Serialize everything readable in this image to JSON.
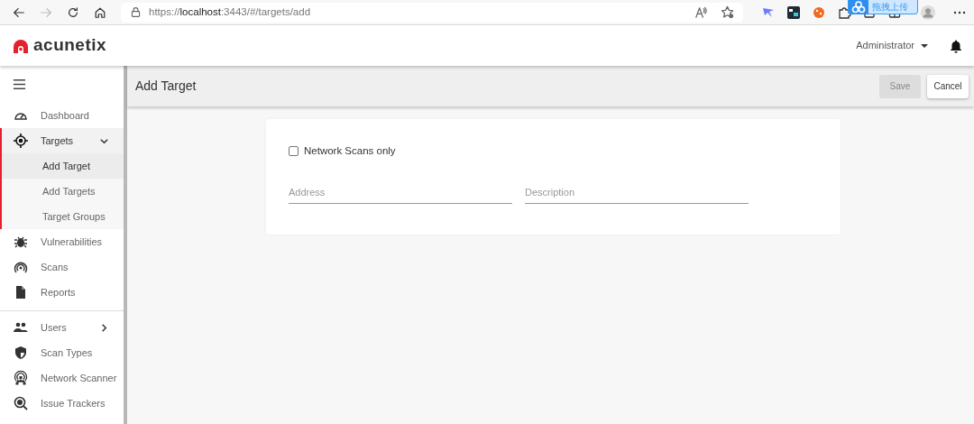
{
  "browser": {
    "url_scheme": "https://",
    "url_host": "localhost",
    "url_path": ":3443/#/targets/add",
    "forward_disabled": true,
    "overlay_label": "拖拽上传"
  },
  "app": {
    "logo": "acunetix",
    "user": "Administrator"
  },
  "sidebar": {
    "groups": [
      [
        {
          "label": "Dashboard",
          "selected": false
        },
        {
          "label": "Targets",
          "selected": true,
          "expanded": true,
          "children": [
            {
              "label": "Add Target",
              "selected": true
            },
            {
              "label": "Add Targets",
              "selected": false
            },
            {
              "label": "Target Groups",
              "selected": false
            }
          ]
        },
        {
          "label": "Vulnerabilities",
          "selected": false
        },
        {
          "label": "Scans",
          "selected": false
        },
        {
          "label": "Reports",
          "selected": false
        }
      ],
      [
        {
          "label": "Users",
          "selected": false,
          "expanded": false
        },
        {
          "label": "Scan Types",
          "selected": false
        },
        {
          "label": "Network Scanner",
          "selected": false
        },
        {
          "label": "Issue Trackers",
          "selected": false
        }
      ]
    ]
  },
  "page": {
    "title": "Add Target",
    "buttons": [
      {
        "label": "Save",
        "disabled": true
      },
      {
        "label": "Cancel",
        "disabled": false
      }
    ],
    "form": {
      "checkbox": {
        "label": "Network Scans only",
        "checked": false
      },
      "fields": [
        {
          "placeholder": "Address"
        },
        {
          "placeholder": "Description"
        }
      ]
    }
  }
}
